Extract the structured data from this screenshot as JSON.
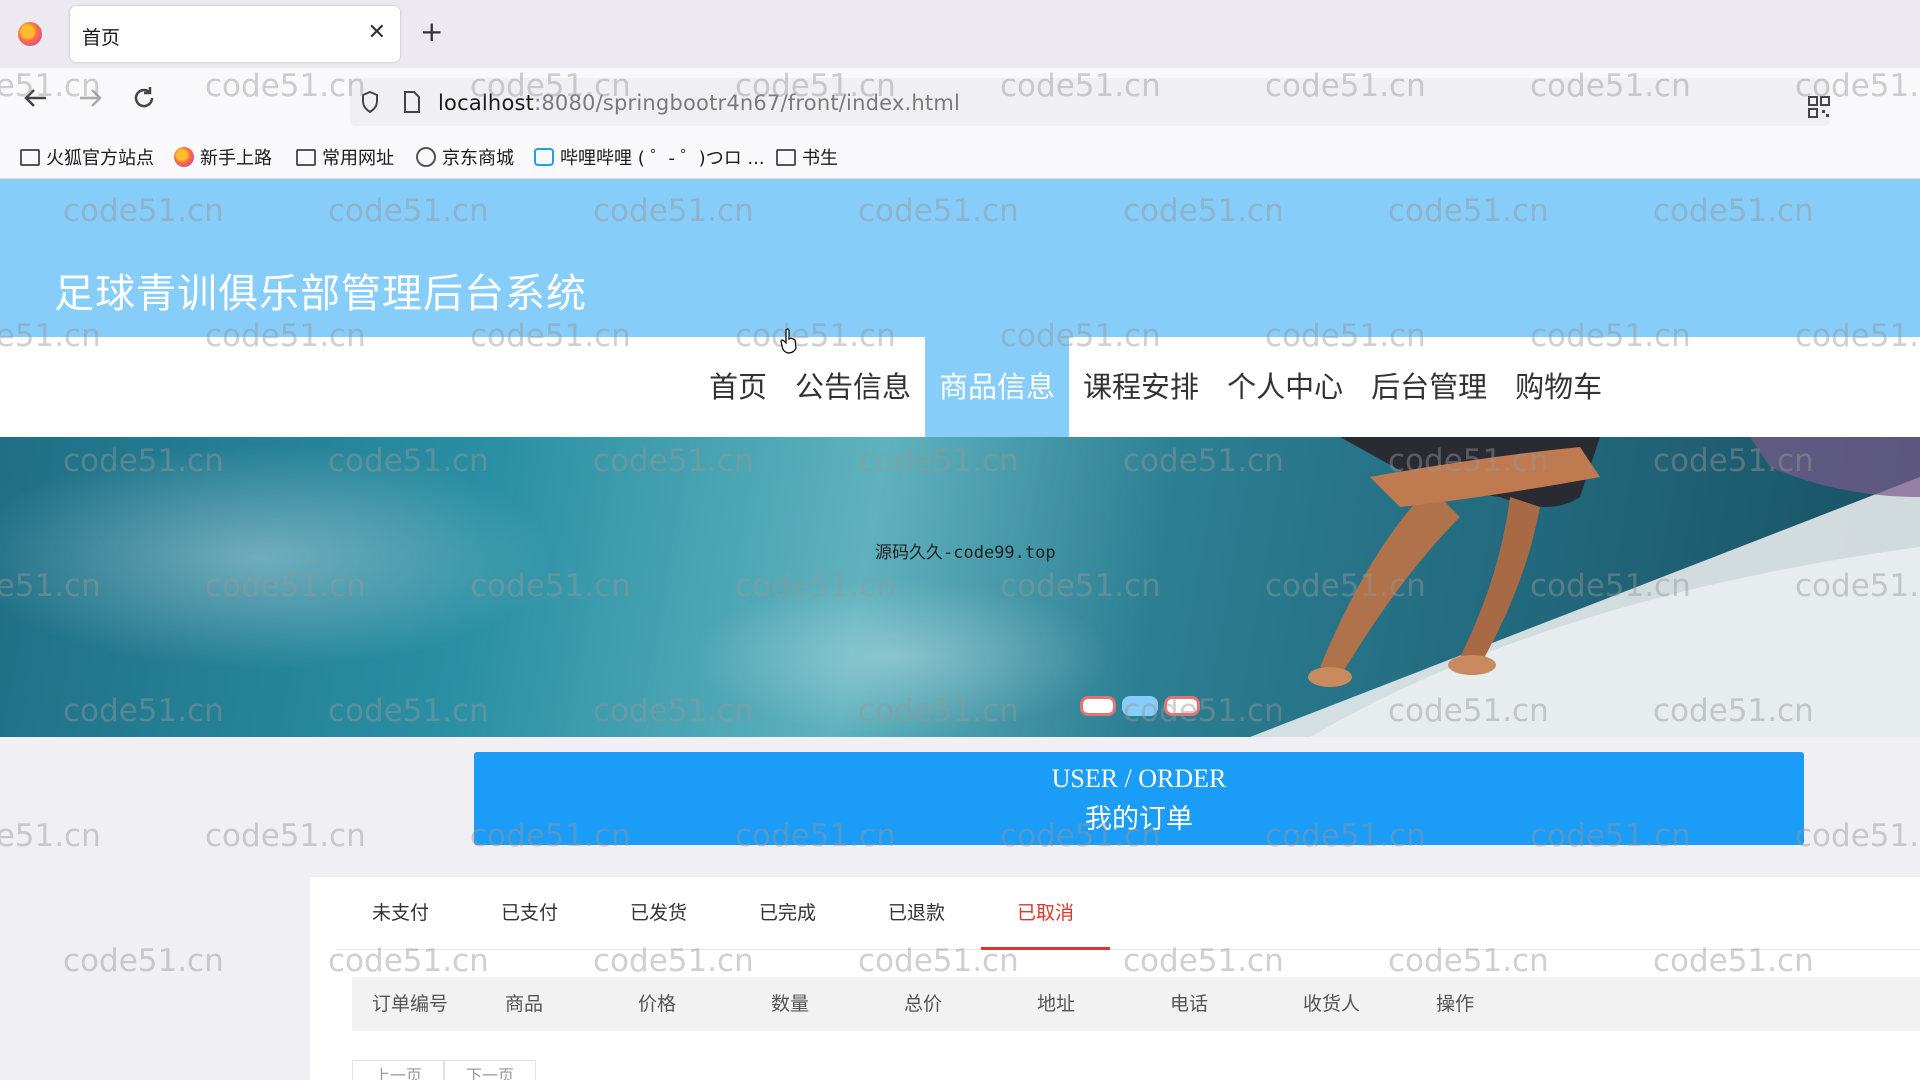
{
  "browser": {
    "tab_title": "首页",
    "tab_close": "✕",
    "new_tab": "+",
    "url_host": "localhost",
    "url_path": ":8080/springbootr4n67/front/index.html",
    "bookmarks": [
      {
        "label": "火狐官方站点",
        "icon": "folder-icon"
      },
      {
        "label": "新手上路",
        "icon": "firefox-icon"
      },
      {
        "label": "常用网址",
        "icon": "folder-icon"
      },
      {
        "label": "京东商城",
        "icon": "globe-icon"
      },
      {
        "label": "哔哩哔哩 ( ゜- ゜)つロ ...",
        "icon": "bilibili-icon"
      },
      {
        "label": "书生",
        "icon": "folder-icon"
      }
    ]
  },
  "site": {
    "title": "足球青训俱乐部管理后台系统",
    "menu": [
      "首页",
      "公告信息",
      "商品信息",
      "课程安排",
      "个人中心",
      "后台管理",
      "购物车"
    ],
    "active_menu": "商品信息"
  },
  "banner": {
    "caption": "源码久久-code99.top",
    "slides": 3,
    "active_slide": 2
  },
  "order_section": {
    "title_en": "USER / ORDER",
    "title_cn": "我的订单",
    "tabs": [
      "未支付",
      "已支付",
      "已发货",
      "已完成",
      "已退款",
      "已取消"
    ],
    "active_tab": "已取消",
    "columns": [
      "订单编号",
      "商品",
      "价格",
      "数量",
      "总价",
      "地址",
      "电话",
      "收货人",
      "操作"
    ],
    "pager": [
      "上一页",
      "下一页"
    ]
  },
  "watermark": "code51.cn",
  "colors": {
    "header_bg": "#87cdfa",
    "order_banner": "#1a9cf7",
    "active_tab": "#e0352b"
  }
}
